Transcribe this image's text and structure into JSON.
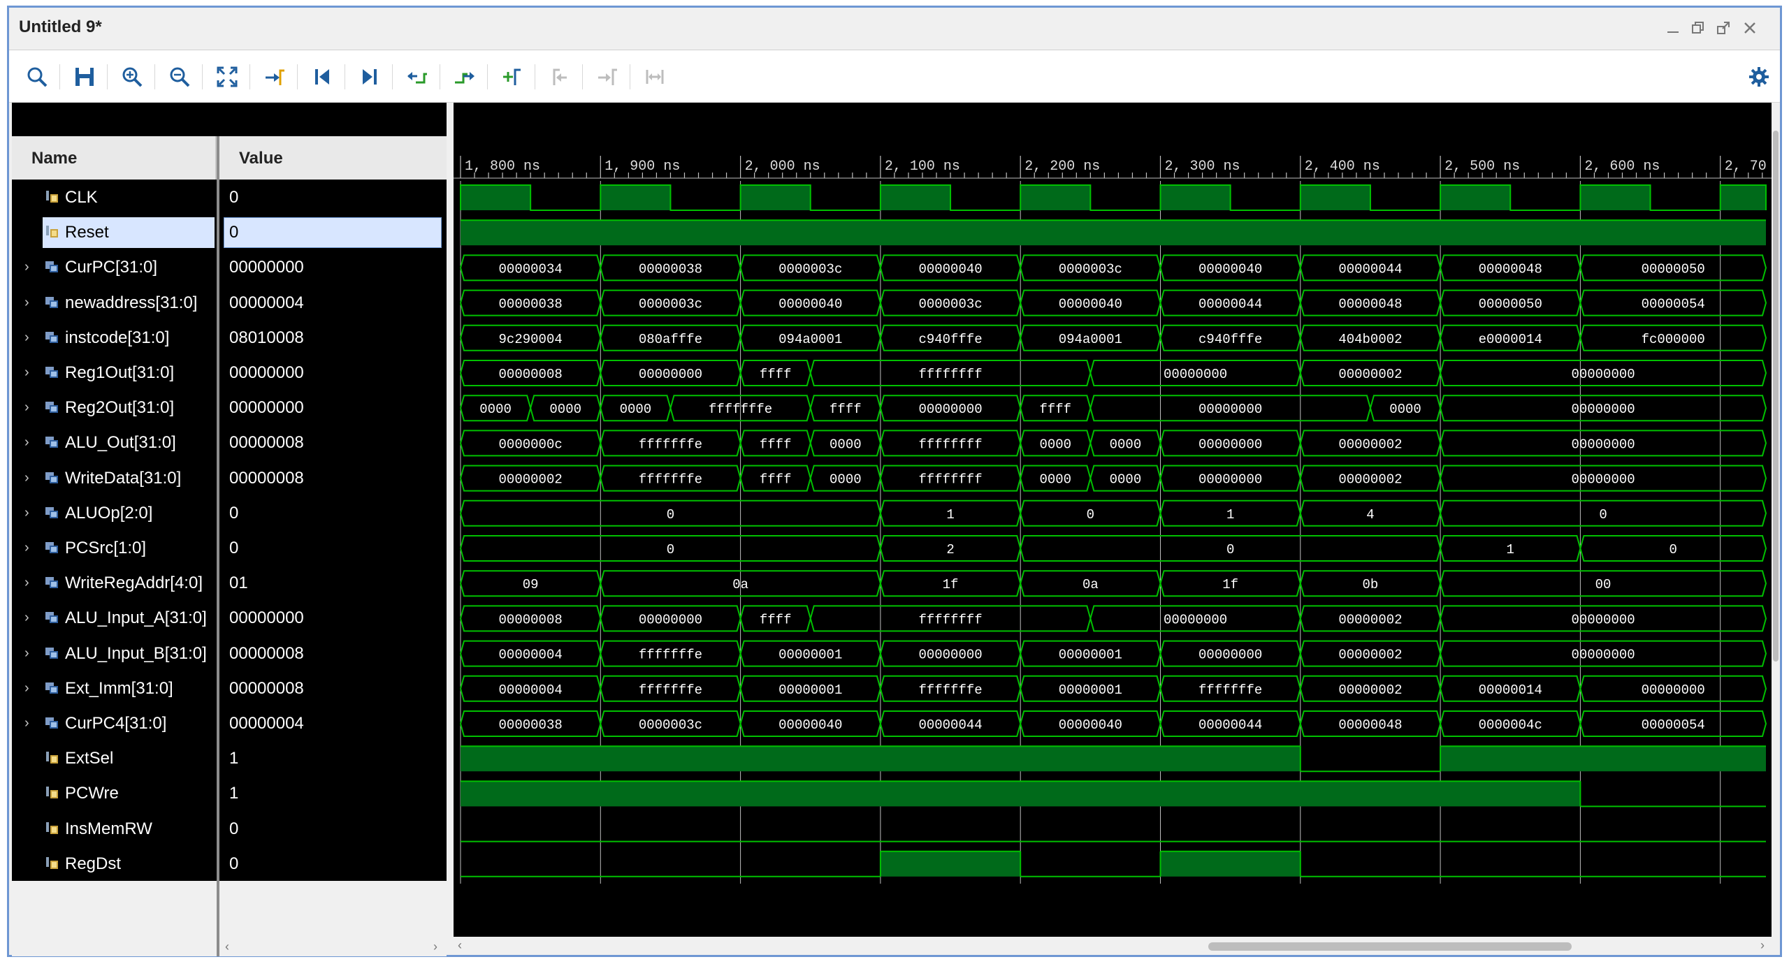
{
  "window": {
    "title": "Untitled 9*"
  },
  "icons": {
    "toolbar": [
      "search-icon",
      "save-icon",
      "zoom-in-icon",
      "zoom-out-icon",
      "zoom-fit-icon",
      "go-to-cursor-icon",
      "go-to-time-zero-icon",
      "go-to-last-time-icon",
      "previous-transition-icon",
      "next-transition-icon",
      "add-marker-icon",
      "previous-marker-icon",
      "next-marker-icon",
      "swap-cursors-icon"
    ],
    "settings": "gear-icon"
  },
  "columns": {
    "name": "Name",
    "value": "Value"
  },
  "colors": {
    "wave": "#00c000",
    "wave_fill": "#006a1a",
    "grid": "#bfbfbf",
    "selection": "#d8e6ff"
  },
  "timeline": {
    "labels": [
      "1, 800 ns",
      "1, 900 ns",
      "2, 000 ns",
      "2, 100 ns",
      "2, 200 ns",
      "2, 300 ns",
      "2, 400 ns",
      "2, 500 ns",
      "2, 600 ns",
      "2, 70"
    ]
  },
  "signals": [
    {
      "name": "CLK",
      "value": "0",
      "type": "bit",
      "expandable": false,
      "selected": false
    },
    {
      "name": "Reset",
      "value": "0",
      "type": "bit",
      "expandable": false,
      "selected": true
    },
    {
      "name": "CurPC[31:0]",
      "value": "00000000",
      "type": "bus",
      "expandable": true,
      "selected": false
    },
    {
      "name": "newaddress[31:0]",
      "value": "00000004",
      "type": "bus",
      "expandable": true,
      "selected": false
    },
    {
      "name": "instcode[31:0]",
      "value": "08010008",
      "type": "bus",
      "expandable": true,
      "selected": false
    },
    {
      "name": "Reg1Out[31:0]",
      "value": "00000000",
      "type": "bus",
      "expandable": true,
      "selected": false
    },
    {
      "name": "Reg2Out[31:0]",
      "value": "00000000",
      "type": "bus",
      "expandable": true,
      "selected": false
    },
    {
      "name": "ALU_Out[31:0]",
      "value": "00000008",
      "type": "bus",
      "expandable": true,
      "selected": false
    },
    {
      "name": "WriteData[31:0]",
      "value": "00000008",
      "type": "bus",
      "expandable": true,
      "selected": false
    },
    {
      "name": "ALUOp[2:0]",
      "value": "0",
      "type": "bus",
      "expandable": true,
      "selected": false
    },
    {
      "name": "PCSrc[1:0]",
      "value": "0",
      "type": "bus",
      "expandable": true,
      "selected": false
    },
    {
      "name": "WriteRegAddr[4:0]",
      "value": "01",
      "type": "bus",
      "expandable": true,
      "selected": false
    },
    {
      "name": "ALU_Input_A[31:0]",
      "value": "00000000",
      "type": "bus",
      "expandable": true,
      "selected": false
    },
    {
      "name": "ALU_Input_B[31:0]",
      "value": "00000008",
      "type": "bus",
      "expandable": true,
      "selected": false
    },
    {
      "name": "Ext_Imm[31:0]",
      "value": "00000008",
      "type": "bus",
      "expandable": true,
      "selected": false
    },
    {
      "name": "CurPC4[31:0]",
      "value": "00000004",
      "type": "bus",
      "expandable": true,
      "selected": false
    },
    {
      "name": "ExtSel",
      "value": "1",
      "type": "bit",
      "expandable": false,
      "selected": false
    },
    {
      "name": "PCWre",
      "value": "1",
      "type": "bit",
      "expandable": false,
      "selected": false
    },
    {
      "name": "InsMemRW",
      "value": "0",
      "type": "bit",
      "expandable": false,
      "selected": false
    },
    {
      "name": "RegDst",
      "value": "0",
      "type": "bit",
      "expandable": false,
      "selected": false
    }
  ],
  "waves": [
    {
      "kind": "clock",
      "high_first": true
    },
    {
      "kind": "bit",
      "segments": [
        [
          0,
          10,
          1
        ]
      ]
    },
    {
      "kind": "bus",
      "segments": [
        [
          0,
          1,
          "00000034"
        ],
        [
          1,
          2,
          "00000038"
        ],
        [
          2,
          3,
          "0000003c"
        ],
        [
          3,
          4,
          "00000040"
        ],
        [
          4,
          5,
          "0000003c"
        ],
        [
          5,
          6,
          "00000040"
        ],
        [
          6,
          7,
          "00000044"
        ],
        [
          7,
          8,
          "00000048"
        ],
        [
          8,
          10,
          "00000050"
        ]
      ]
    },
    {
      "kind": "bus",
      "segments": [
        [
          0,
          1,
          "00000038"
        ],
        [
          1,
          2,
          "0000003c"
        ],
        [
          2,
          3,
          "00000040"
        ],
        [
          3,
          4,
          "0000003c"
        ],
        [
          4,
          5,
          "00000040"
        ],
        [
          5,
          6,
          "00000044"
        ],
        [
          6,
          7,
          "00000048"
        ],
        [
          7,
          8,
          "00000050"
        ],
        [
          8,
          10,
          "00000054"
        ]
      ]
    },
    {
      "kind": "bus",
      "segments": [
        [
          0,
          1,
          "9c290004"
        ],
        [
          1,
          2,
          "080afffe"
        ],
        [
          2,
          3,
          "094a0001"
        ],
        [
          3,
          4,
          "c940fffe"
        ],
        [
          4,
          5,
          "094a0001"
        ],
        [
          5,
          6,
          "c940fffe"
        ],
        [
          6,
          7,
          "404b0002"
        ],
        [
          7,
          8,
          "e0000014"
        ],
        [
          8,
          10,
          "fc000000"
        ]
      ]
    },
    {
      "kind": "bus",
      "segments": [
        [
          0,
          1,
          "00000008"
        ],
        [
          1,
          2,
          "00000000"
        ],
        [
          2,
          2.5,
          "ffff"
        ],
        [
          2.5,
          4.5,
          "ffffffff"
        ],
        [
          4.5,
          6,
          "00000000"
        ],
        [
          6,
          7,
          "00000002"
        ],
        [
          7,
          10,
          "00000000"
        ]
      ]
    },
    {
      "kind": "bus",
      "segments": [
        [
          0,
          0.5,
          "0000"
        ],
        [
          0.5,
          1,
          "0000"
        ],
        [
          1,
          1.5,
          "0000"
        ],
        [
          1.5,
          2.5,
          "fffffffe"
        ],
        [
          2.5,
          3,
          "ffff"
        ],
        [
          3,
          4,
          "00000000"
        ],
        [
          4,
          4.5,
          "ffff"
        ],
        [
          4.5,
          6.5,
          "00000000"
        ],
        [
          6.5,
          7,
          "0000"
        ],
        [
          7,
          10,
          "00000000"
        ]
      ]
    },
    {
      "kind": "bus",
      "segments": [
        [
          0,
          1,
          "0000000c"
        ],
        [
          1,
          2,
          "fffffffe"
        ],
        [
          2,
          2.5,
          "ffff"
        ],
        [
          2.5,
          3,
          "0000"
        ],
        [
          3,
          4,
          "ffffffff"
        ],
        [
          4,
          4.5,
          "0000"
        ],
        [
          4.5,
          5,
          "0000"
        ],
        [
          5,
          6,
          "00000000"
        ],
        [
          6,
          7,
          "00000002"
        ],
        [
          7,
          10,
          "00000000"
        ]
      ]
    },
    {
      "kind": "bus",
      "segments": [
        [
          0,
          1,
          "00000002"
        ],
        [
          1,
          2,
          "fffffffe"
        ],
        [
          2,
          2.5,
          "ffff"
        ],
        [
          2.5,
          3,
          "0000"
        ],
        [
          3,
          4,
          "ffffffff"
        ],
        [
          4,
          4.5,
          "0000"
        ],
        [
          4.5,
          5,
          "0000"
        ],
        [
          5,
          6,
          "00000000"
        ],
        [
          6,
          7,
          "00000002"
        ],
        [
          7,
          10,
          "00000000"
        ]
      ]
    },
    {
      "kind": "bus",
      "segments": [
        [
          0,
          3,
          "0"
        ],
        [
          3,
          4,
          "1"
        ],
        [
          4,
          5,
          "0"
        ],
        [
          5,
          6,
          "1"
        ],
        [
          6,
          7,
          "4"
        ],
        [
          7,
          10,
          "0"
        ]
      ]
    },
    {
      "kind": "bus",
      "segments": [
        [
          0,
          3,
          "0"
        ],
        [
          3,
          4,
          "2"
        ],
        [
          4,
          7,
          "0"
        ],
        [
          7,
          8,
          "1"
        ],
        [
          8,
          10,
          "0"
        ]
      ]
    },
    {
      "kind": "bus",
      "segments": [
        [
          0,
          1,
          "09"
        ],
        [
          1,
          3,
          "0a"
        ],
        [
          3,
          4,
          "1f"
        ],
        [
          4,
          5,
          "0a"
        ],
        [
          5,
          6,
          "1f"
        ],
        [
          6,
          7,
          "0b"
        ],
        [
          7,
          10,
          "00"
        ]
      ]
    },
    {
      "kind": "bus",
      "segments": [
        [
          0,
          1,
          "00000008"
        ],
        [
          1,
          2,
          "00000000"
        ],
        [
          2,
          2.5,
          "ffff"
        ],
        [
          2.5,
          4.5,
          "ffffffff"
        ],
        [
          4.5,
          6,
          "00000000"
        ],
        [
          6,
          7,
          "00000002"
        ],
        [
          7,
          10,
          "00000000"
        ]
      ]
    },
    {
      "kind": "bus",
      "segments": [
        [
          0,
          1,
          "00000004"
        ],
        [
          1,
          2,
          "fffffffe"
        ],
        [
          2,
          3,
          "00000001"
        ],
        [
          3,
          4,
          "00000000"
        ],
        [
          4,
          5,
          "00000001"
        ],
        [
          5,
          6,
          "00000000"
        ],
        [
          6,
          7,
          "00000002"
        ],
        [
          7,
          10,
          "00000000"
        ]
      ]
    },
    {
      "kind": "bus",
      "segments": [
        [
          0,
          1,
          "00000004"
        ],
        [
          1,
          2,
          "fffffffe"
        ],
        [
          2,
          3,
          "00000001"
        ],
        [
          3,
          4,
          "fffffffe"
        ],
        [
          4,
          5,
          "00000001"
        ],
        [
          5,
          6,
          "fffffffe"
        ],
        [
          6,
          7,
          "00000002"
        ],
        [
          7,
          8,
          "00000014"
        ],
        [
          8,
          10,
          "00000000"
        ]
      ]
    },
    {
      "kind": "bus",
      "segments": [
        [
          0,
          1,
          "00000038"
        ],
        [
          1,
          2,
          "0000003c"
        ],
        [
          2,
          3,
          "00000040"
        ],
        [
          3,
          4,
          "00000044"
        ],
        [
          4,
          5,
          "00000040"
        ],
        [
          5,
          6,
          "00000044"
        ],
        [
          6,
          7,
          "00000048"
        ],
        [
          7,
          8,
          "0000004c"
        ],
        [
          8,
          10,
          "00000054"
        ]
      ]
    },
    {
      "kind": "bit",
      "segments": [
        [
          0,
          6,
          1
        ],
        [
          6,
          7,
          0
        ],
        [
          7,
          10,
          1
        ]
      ]
    },
    {
      "kind": "bit",
      "segments": [
        [
          0,
          8,
          1
        ],
        [
          8,
          10,
          0
        ]
      ]
    },
    {
      "kind": "bit",
      "segments": [
        [
          0,
          10,
          0
        ]
      ]
    },
    {
      "kind": "bit",
      "segments": [
        [
          0,
          3,
          0
        ],
        [
          3,
          4,
          1
        ],
        [
          4,
          5,
          0
        ],
        [
          5,
          6,
          1
        ],
        [
          6,
          10,
          0
        ]
      ]
    }
  ]
}
